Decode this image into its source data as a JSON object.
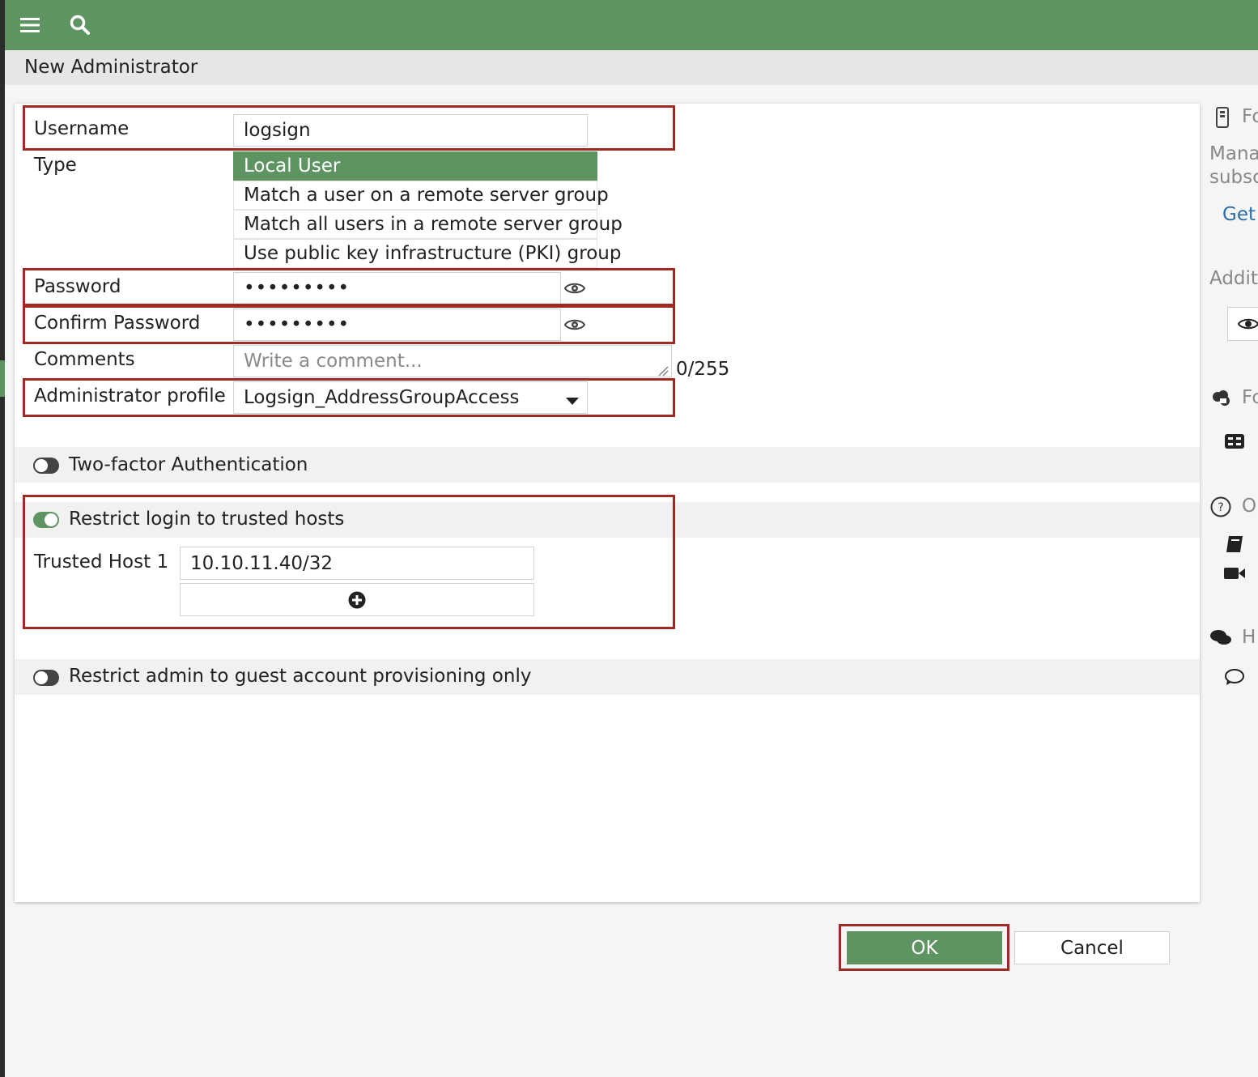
{
  "header": {
    "title": "New Administrator"
  },
  "topbar": {
    "menu_icon": "hamburger-menu-icon",
    "search_icon": "search-icon"
  },
  "form": {
    "username": {
      "label": "Username",
      "value": "logsign"
    },
    "type": {
      "label": "Type",
      "options": [
        "Local User",
        "Match a user on a remote server group",
        "Match all users in a remote server group",
        "Use public key infrastructure (PKI) group"
      ],
      "selected": "Local User"
    },
    "password": {
      "label": "Password",
      "value": "•••••••••"
    },
    "confirm_password": {
      "label": "Confirm Password",
      "value": "•••••••••"
    },
    "comments": {
      "label": "Comments",
      "placeholder": "Write a comment...",
      "counter": "0/255"
    },
    "admin_profile": {
      "label": "Administrator profile",
      "value": "Logsign_AddressGroupAccess"
    }
  },
  "two_factor": {
    "label": "Two-factor Authentication",
    "enabled": false
  },
  "trusted_hosts": {
    "label": "Restrict login to trusted hosts",
    "enabled": true,
    "host1_label": "Trusted Host 1",
    "host1_value": "10.10.11.40/32"
  },
  "guest_provisioning": {
    "label": "Restrict admin to guest account provisioning only",
    "enabled": false
  },
  "buttons": {
    "ok": "OK",
    "cancel": "Cancel"
  },
  "sidebar": {
    "fo1": "Fo",
    "mana": "Mana",
    "subsc": "subsc",
    "get": "Get",
    "addit": "Addit",
    "fo2": "Fo",
    "o": "O",
    "h": "H"
  },
  "colors": {
    "accent": "#5e9462",
    "highlight": "#9e2a22"
  }
}
